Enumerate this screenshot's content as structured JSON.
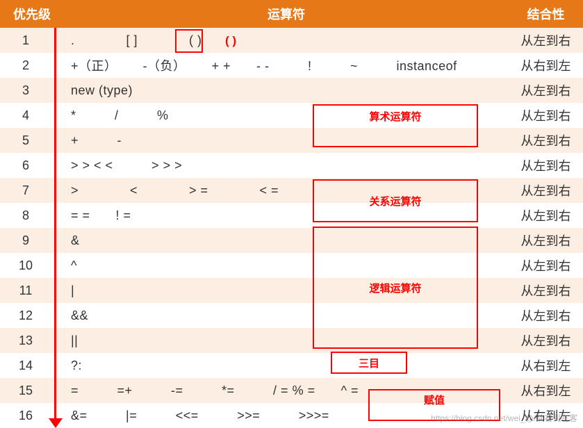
{
  "header": {
    "priority": "优先级",
    "operator": "运算符",
    "associativity": "结合性"
  },
  "assoc": {
    "ltr": "从左到右",
    "rtl": "从右到左"
  },
  "rows": [
    {
      "priority": "1",
      "ops": ".    [ ]    ( )",
      "assoc": "从左到右"
    },
    {
      "priority": "2",
      "ops": "+（正）  -（负）  + +  - -   !   ~   instanceof",
      "assoc": "从右到左"
    },
    {
      "priority": "3",
      "ops": "new  (type)",
      "assoc": "从左到右"
    },
    {
      "priority": "4",
      "ops": "*   /   %",
      "assoc": "从左到右"
    },
    {
      "priority": "5",
      "ops": "+   -",
      "assoc": "从左到右"
    },
    {
      "priority": "6",
      "ops": "> >   < <   > > >",
      "assoc": "从左到右"
    },
    {
      "priority": "7",
      "ops": ">    <    > =    < =",
      "assoc": "从左到右"
    },
    {
      "priority": "8",
      "ops": "= =  ! =",
      "assoc": "从左到右"
    },
    {
      "priority": "9",
      "ops": "&",
      "assoc": "从左到右"
    },
    {
      "priority": "10",
      "ops": "^",
      "assoc": "从左到右"
    },
    {
      "priority": "11",
      "ops": "|",
      "assoc": "从左到右"
    },
    {
      "priority": "12",
      "ops": "&&",
      "assoc": "从左到右"
    },
    {
      "priority": "13",
      "ops": "||",
      "assoc": "从左到右"
    },
    {
      "priority": "14",
      "ops": "?:",
      "assoc": "从右到左"
    },
    {
      "priority": "15",
      "ops": "=   =+   -=   *=   / =  % =  ^ =",
      "assoc": "从右到左"
    },
    {
      "priority": "16",
      "ops": "&=   |=   <<=   >>=   >>>=",
      "assoc": "从右到左"
    }
  ],
  "annotations": {
    "paren_extra": "( )",
    "labels": {
      "arithmetic": "算术运算符",
      "relational": "关系运算符",
      "logical": "逻辑运算符",
      "ternary": "三目",
      "assignment": "赋值"
    }
  },
  "watermark": "https://blog.csdn.net/wei_@/从右到左客"
}
